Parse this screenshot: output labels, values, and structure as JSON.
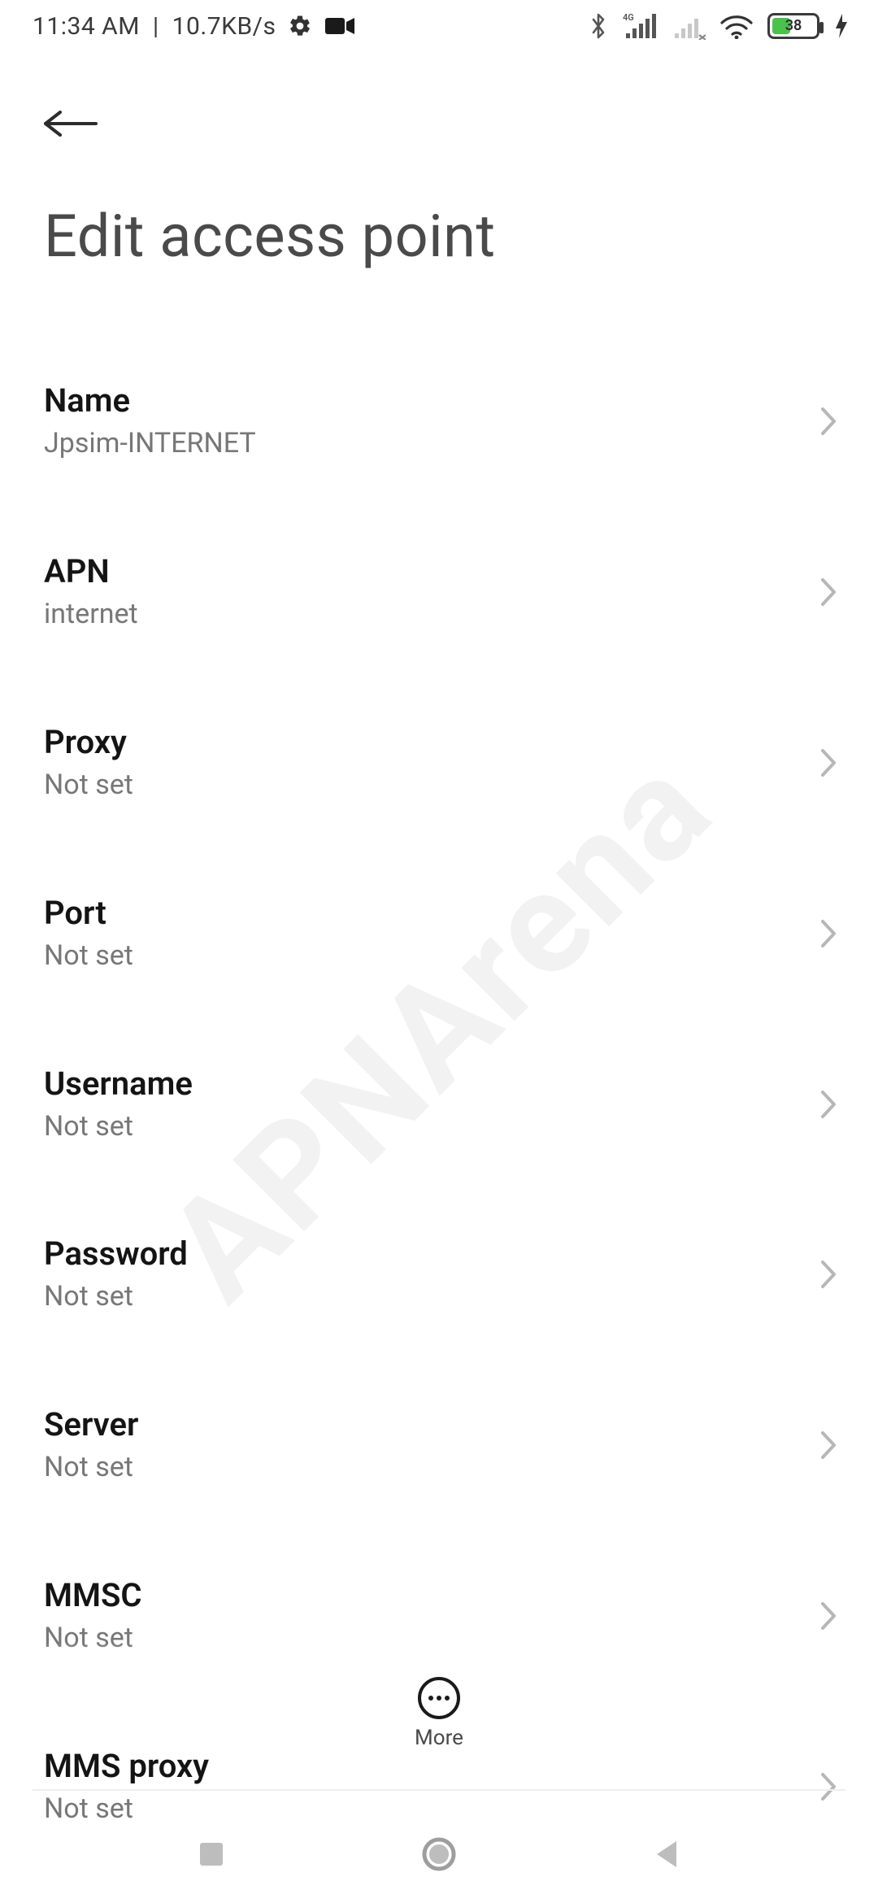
{
  "status": {
    "time": "11:34 AM",
    "net": "10.7KB/s",
    "battery_pct": "38",
    "battery_fill_pct": 38
  },
  "header": {
    "title": "Edit access point"
  },
  "settings": [
    {
      "title": "Name",
      "value": "Jpsim-INTERNET"
    },
    {
      "title": "APN",
      "value": "internet"
    },
    {
      "title": "Proxy",
      "value": "Not set"
    },
    {
      "title": "Port",
      "value": "Not set"
    },
    {
      "title": "Username",
      "value": "Not set"
    },
    {
      "title": "Password",
      "value": "Not set"
    },
    {
      "title": "Server",
      "value": "Not set"
    },
    {
      "title": "MMSC",
      "value": "Not set"
    },
    {
      "title": "MMS proxy",
      "value": "Not set"
    }
  ],
  "more_label": "More",
  "watermark": "APNArena"
}
